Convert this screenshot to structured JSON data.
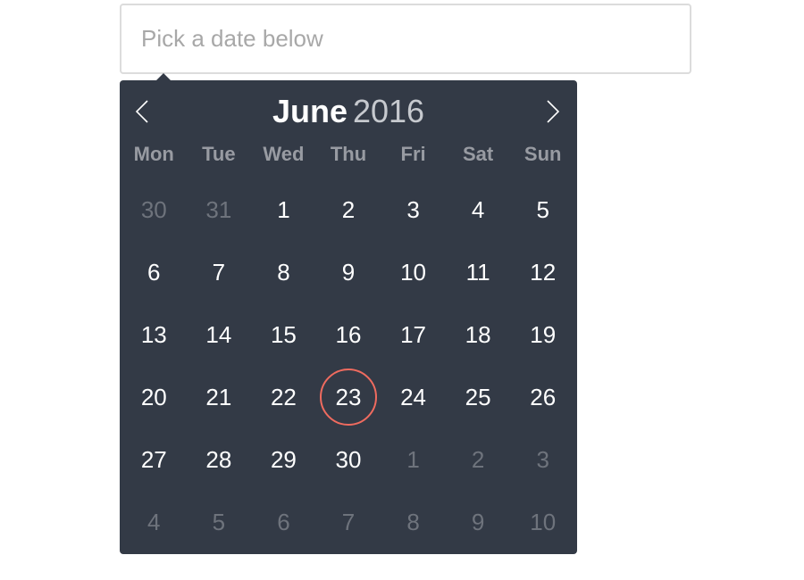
{
  "input": {
    "placeholder": "Pick a date below",
    "value": ""
  },
  "calendar": {
    "month": "June",
    "year": "2016",
    "prev_icon": "chevron-left-icon",
    "next_icon": "chevron-right-icon",
    "accent_color": "#ef6b5f",
    "background_color": "#333a46",
    "weekdays": [
      "Mon",
      "Tue",
      "Wed",
      "Thu",
      "Fri",
      "Sat",
      "Sun"
    ],
    "selected_day": "23",
    "weeks": [
      [
        {
          "d": "30",
          "muted": true
        },
        {
          "d": "31",
          "muted": true
        },
        {
          "d": "1"
        },
        {
          "d": "2"
        },
        {
          "d": "3"
        },
        {
          "d": "4"
        },
        {
          "d": "5"
        }
      ],
      [
        {
          "d": "6"
        },
        {
          "d": "7"
        },
        {
          "d": "8"
        },
        {
          "d": "9"
        },
        {
          "d": "10"
        },
        {
          "d": "11"
        },
        {
          "d": "12"
        }
      ],
      [
        {
          "d": "13"
        },
        {
          "d": "14"
        },
        {
          "d": "15"
        },
        {
          "d": "16"
        },
        {
          "d": "17"
        },
        {
          "d": "18"
        },
        {
          "d": "19"
        }
      ],
      [
        {
          "d": "20"
        },
        {
          "d": "21"
        },
        {
          "d": "22"
        },
        {
          "d": "23",
          "selected": true
        },
        {
          "d": "24"
        },
        {
          "d": "25"
        },
        {
          "d": "26"
        }
      ],
      [
        {
          "d": "27"
        },
        {
          "d": "28"
        },
        {
          "d": "29"
        },
        {
          "d": "30"
        },
        {
          "d": "1",
          "muted": true
        },
        {
          "d": "2",
          "muted": true
        },
        {
          "d": "3",
          "muted": true
        }
      ],
      [
        {
          "d": "4",
          "muted": true
        },
        {
          "d": "5",
          "muted": true
        },
        {
          "d": "6",
          "muted": true
        },
        {
          "d": "7",
          "muted": true
        },
        {
          "d": "8",
          "muted": true
        },
        {
          "d": "9",
          "muted": true
        },
        {
          "d": "10",
          "muted": true
        }
      ]
    ]
  }
}
